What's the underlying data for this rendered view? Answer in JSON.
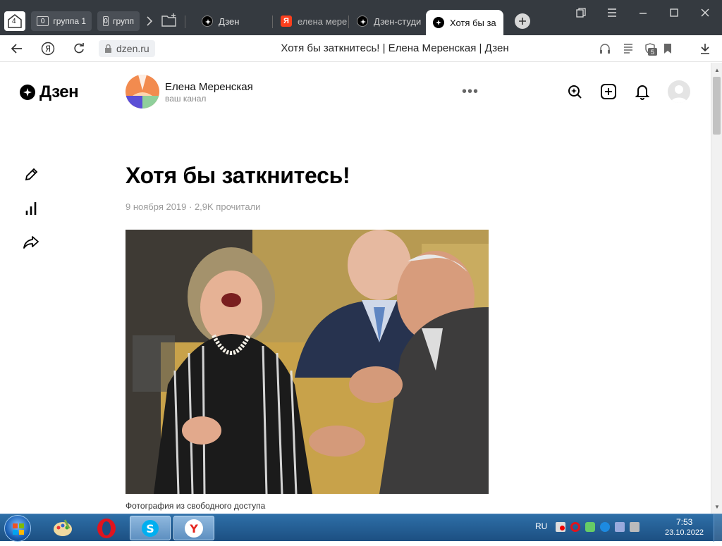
{
  "browser": {
    "tab_groups_count": "4",
    "groups": [
      {
        "count": "0",
        "label": "группа 1"
      },
      {
        "count": "0",
        "label": "групп"
      }
    ],
    "tabs": [
      {
        "label": "Дзен",
        "icon": "zen-icon"
      },
      {
        "label": "елена мере",
        "icon": "yandex-icon"
      },
      {
        "label": "Дзен-студи",
        "icon": "zen-icon"
      },
      {
        "label": "Хотя бы за",
        "icon": "zen-icon",
        "active": true
      }
    ],
    "url": "dzen.ru",
    "page_title": "Хотя бы заткнитесь! | Елена Меренская | Дзен",
    "reader_badge": "5"
  },
  "page": {
    "brand": "Дзен",
    "channel": {
      "name": "Елена Меренская",
      "subtitle": "ваш канал"
    },
    "more_label": "•••",
    "article": {
      "title": "Хотя бы заткнитесь!",
      "meta": "9 ноября 2019 · 2,9K прочитали",
      "photo_caption": "Фотография из свободного доступа"
    }
  },
  "taskbar": {
    "language": "RU",
    "time": "7:53",
    "date": "23.10.2022"
  },
  "colors": {
    "tabstrip": "#353a40",
    "accent_zen": "#000000",
    "yandex_red": "#fc3f1d",
    "taskbar": "#1c4f82"
  }
}
